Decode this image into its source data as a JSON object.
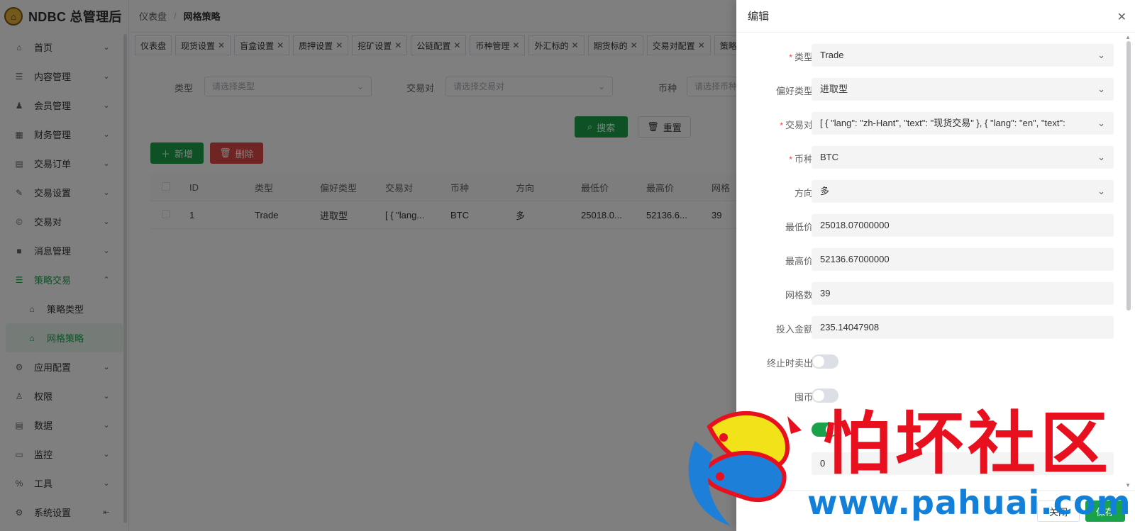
{
  "app": {
    "title": "NDBC 总管理后"
  },
  "breadcrumb": [
    "仪表盘",
    "网格策略"
  ],
  "sidebar": {
    "items": [
      {
        "label": "首页",
        "icon": "home-icon",
        "glyph": "⌂",
        "arrow": "⌄"
      },
      {
        "label": "内容管理",
        "icon": "list-icon",
        "glyph": "☰",
        "arrow": "⌄"
      },
      {
        "label": "会员管理",
        "icon": "user-icon",
        "glyph": "♟",
        "arrow": "⌄"
      },
      {
        "label": "财务管理",
        "icon": "table-icon",
        "glyph": "▦",
        "arrow": "⌄"
      },
      {
        "label": "交易订单",
        "icon": "order-icon",
        "glyph": "▤",
        "arrow": "⌄"
      },
      {
        "label": "交易设置",
        "icon": "wrench-icon",
        "glyph": "✎",
        "arrow": "⌄"
      },
      {
        "label": "交易对",
        "icon": "copyright-icon",
        "glyph": "©",
        "arrow": "⌄"
      },
      {
        "label": "消息管理",
        "icon": "message-icon",
        "glyph": "■",
        "arrow": "⌄"
      },
      {
        "label": "策略交易",
        "icon": "strategy-icon",
        "glyph": "☰",
        "arrow": "⌃"
      }
    ],
    "sub_items": [
      {
        "label": "策略类型",
        "icon": "home-icon",
        "glyph": "⌂"
      },
      {
        "label": "网格策略",
        "icon": "home-icon",
        "glyph": "⌂"
      }
    ],
    "items_after": [
      {
        "label": "应用配置",
        "icon": "app-config-icon",
        "glyph": "⚙",
        "arrow": "⌄"
      },
      {
        "label": "权限",
        "icon": "permission-icon",
        "glyph": "♙",
        "arrow": "⌄"
      },
      {
        "label": "数据",
        "icon": "data-icon",
        "glyph": "▤",
        "arrow": "⌄"
      },
      {
        "label": "监控",
        "icon": "monitor-icon",
        "glyph": "▭",
        "arrow": "⌄"
      },
      {
        "label": "工具",
        "icon": "tool-icon",
        "glyph": "%",
        "arrow": "⌄"
      },
      {
        "label": "系统设置",
        "icon": "settings-icon",
        "glyph": "⚙",
        "arrow": "⇤"
      }
    ]
  },
  "tags": [
    {
      "label": "仪表盘",
      "closable": false
    },
    {
      "label": "现货设置",
      "closable": true
    },
    {
      "label": "盲盒设置",
      "closable": true
    },
    {
      "label": "质押设置",
      "closable": true
    },
    {
      "label": "挖矿设置",
      "closable": true
    },
    {
      "label": "公链配置",
      "closable": true
    },
    {
      "label": "币种管理",
      "closable": true
    },
    {
      "label": "外汇标的",
      "closable": true
    },
    {
      "label": "期货标的",
      "closable": true
    },
    {
      "label": "交易对配置",
      "closable": true
    },
    {
      "label": "策略",
      "closable": false
    }
  ],
  "filters": [
    {
      "label": "类型",
      "placeholder": "请选择类型"
    },
    {
      "label": "交易对",
      "placeholder": "请选择交易对"
    },
    {
      "label": "币种",
      "placeholder": "请选择币种"
    }
  ],
  "buttons": {
    "search": "搜索",
    "reset": "重置",
    "add": "新增",
    "delete": "删除"
  },
  "table": {
    "columns": [
      "ID",
      "类型",
      "偏好类型",
      "交易对",
      "币种",
      "方向",
      "最低价",
      "最高价",
      "网格"
    ],
    "rows": [
      [
        "1",
        "Trade",
        "进取型",
        "[ { \"lang...",
        "BTC",
        "多",
        "25018.0...",
        "52136.6...",
        "39"
      ]
    ]
  },
  "drawer": {
    "title": "编辑",
    "fields": [
      {
        "label": "类型",
        "required": true,
        "type": "select",
        "value": "Trade"
      },
      {
        "label": "偏好类型",
        "required": false,
        "type": "select",
        "value": "进取型"
      },
      {
        "label": "交易对",
        "required": true,
        "type": "select",
        "value": "[ { \"lang\": \"zh-Hant\", \"text\": \"现货交易\" }, { \"lang\": \"en\", \"text\":"
      },
      {
        "label": "币种",
        "required": true,
        "type": "select",
        "value": "BTC"
      },
      {
        "label": "方向",
        "required": false,
        "type": "select",
        "value": "多"
      },
      {
        "label": "最低价",
        "required": false,
        "type": "input",
        "value": "25018.07000000"
      },
      {
        "label": "最高价",
        "required": false,
        "type": "input",
        "value": "52136.67000000"
      },
      {
        "label": "网格数",
        "required": false,
        "type": "input",
        "value": "39"
      },
      {
        "label": "投入金额",
        "required": false,
        "type": "input",
        "value": "235.14047908"
      },
      {
        "label": "终止时卖出",
        "required": false,
        "type": "switch",
        "on": false
      },
      {
        "label": "囤币",
        "required": false,
        "type": "switch",
        "on": false
      },
      {
        "label": "",
        "required": false,
        "type": "switch",
        "on": true
      },
      {
        "label": "",
        "required": false,
        "type": "input",
        "value": "0"
      }
    ],
    "footer": {
      "cancel": "关闭",
      "save": "保存"
    }
  },
  "watermark": {
    "text": "怕坏社区",
    "url": "www.pahuai.com"
  },
  "colors": {
    "accent": "#1aa24a",
    "danger": "#e04a4a",
    "watermark_red": "#e8101e",
    "watermark_blue": "#1280d8"
  }
}
